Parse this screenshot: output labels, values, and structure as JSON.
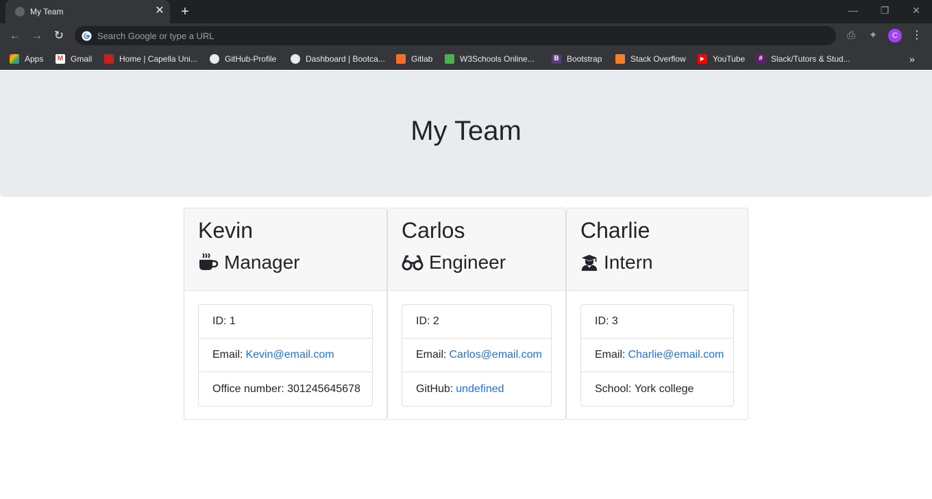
{
  "browser": {
    "tab_title": "My Team",
    "omnibox_placeholder": "Search Google or type a URL",
    "profile_initial": "C",
    "bookmarks": [
      {
        "label": "Apps",
        "icon": "apps-grid-icon",
        "color": "#ea4335"
      },
      {
        "label": "Gmail",
        "icon": "gmail-icon",
        "color": "#ea4335"
      },
      {
        "label": "Home | Capella Uni...",
        "icon": "capella-shield-icon",
        "color": "#c5221f"
      },
      {
        "label": "GitHub-Profile",
        "icon": "github-icon",
        "color": "#e8eaed"
      },
      {
        "label": "Dashboard | Bootca...",
        "icon": "globe-icon",
        "color": "#e8eaed"
      },
      {
        "label": "Gitlab",
        "icon": "gitlab-icon",
        "color": "#fc6d26"
      },
      {
        "label": "W3Schools Online...",
        "icon": "w3schools-icon",
        "color": "#4caf50"
      },
      {
        "label": "Bootstrap",
        "icon": "bootstrap-icon",
        "color": "#563d7c"
      },
      {
        "label": "Stack Overflow",
        "icon": "stackoverflow-icon",
        "color": "#f48024"
      },
      {
        "label": "YouTube",
        "icon": "youtube-icon",
        "color": "#ff0000"
      },
      {
        "label": "Slack/Tutors & Stud...",
        "icon": "slack-icon",
        "color": "#611f69"
      }
    ]
  },
  "page": {
    "title": "My Team",
    "accent_color": "#1a73e8"
  },
  "team": [
    {
      "name": "Kevin",
      "role": "Manager",
      "role_icon": "coffee-mug-icon",
      "id_label": "ID:",
      "id": "1",
      "email_label": "Email:",
      "email": "Kevin@email.com",
      "extra_label": "Office number:",
      "extra_value": "301245645678"
    },
    {
      "name": "Carlos",
      "role": "Engineer",
      "role_icon": "glasses-icon",
      "id_label": "ID:",
      "id": "2",
      "email_label": "Email:",
      "email": "Carlos@email.com",
      "extra_label": "GitHub:",
      "extra_value": "undefined"
    },
    {
      "name": "Charlie",
      "role": "Intern",
      "role_icon": "graduate-icon",
      "id_label": "ID:",
      "id": "3",
      "email_label": "Email:",
      "email": "Charlie@email.com",
      "extra_label": "School:",
      "extra_value": "York college"
    }
  ]
}
